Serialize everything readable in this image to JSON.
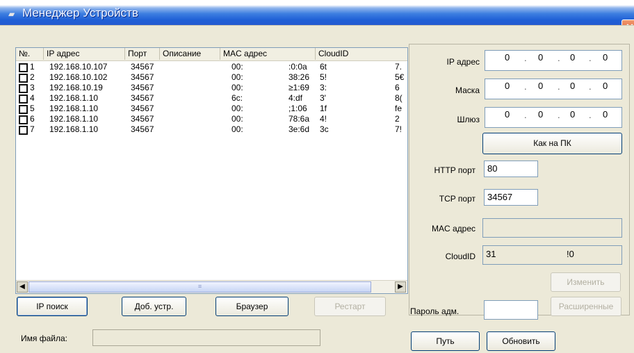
{
  "window": {
    "title": "Менеджер Устройств",
    "close_label": "✕"
  },
  "list": {
    "columns": [
      "№.",
      "IP адрес",
      "Порт",
      "Описание",
      "MAC адрес",
      "CloudID"
    ],
    "rows": [
      {
        "n": "1",
        "ip": "192.168.10.107",
        "port": "34567",
        "desc": "",
        "mac_a": "00:",
        "mac_b": ":0:0a",
        "cloud_a": "6t",
        "cloud_b": "7."
      },
      {
        "n": "2",
        "ip": "192.168.10.102",
        "port": "34567",
        "desc": "",
        "mac_a": "00:",
        "mac_b": "38:26",
        "cloud_a": "5!",
        "cloud_b": "5€"
      },
      {
        "n": "3",
        "ip": "192.168.10.19",
        "port": "34567",
        "desc": "",
        "mac_a": "00:",
        "mac_b": "≥1:69",
        "cloud_a": "3:",
        "cloud_b": "6"
      },
      {
        "n": "4",
        "ip": "192.168.1.10",
        "port": "34567",
        "desc": "",
        "mac_a": "6c:",
        "mac_b": "4:df",
        "cloud_a": "3'",
        "cloud_b": "8("
      },
      {
        "n": "5",
        "ip": "192.168.1.10",
        "port": "34567",
        "desc": "",
        "mac_a": "00:",
        "mac_b": ";1:06",
        "cloud_a": "1f",
        "cloud_b": "fe"
      },
      {
        "n": "6",
        "ip": "192.168.1.10",
        "port": "34567",
        "desc": "",
        "mac_a": "00:",
        "mac_b": "78:6a",
        "cloud_a": "4!",
        "cloud_b": "2"
      },
      {
        "n": "7",
        "ip": "192.168.1.10",
        "port": "34567",
        "desc": "",
        "mac_a": "00:",
        "mac_b": "3e:6d",
        "cloud_a": "3c",
        "cloud_b": "7!"
      }
    ],
    "scroll_left": "◀",
    "scroll_right": "▶",
    "scroll_grip": "≡"
  },
  "buttons": {
    "ip_search": "IP поиск",
    "add_device": "Доб. устр.",
    "browser": "Браузер",
    "restart": "Рестарт",
    "as_pc": "Как на ПК",
    "change": "Изменить",
    "advanced": "Расширенные",
    "path": "Путь",
    "update": "Обновить"
  },
  "settings": {
    "ip_label": "IP адрес",
    "mask_label": "Маска",
    "gateway_label": "Шлюз",
    "ip_octets": [
      "0",
      "0",
      "0",
      "0"
    ],
    "mask_octets": [
      "0",
      "0",
      "0",
      "0"
    ],
    "gateway_octets": [
      "0",
      "0",
      "0",
      "0"
    ],
    "http_label": "HTTP порт",
    "http_value": "80",
    "tcp_label": "TCP порт",
    "tcp_value": "34567",
    "mac_label": "MAC адрес",
    "mac_value": "",
    "cloud_label": "CloudID",
    "cloud_value_a": "31",
    "cloud_value_b": "!0",
    "password_label": "Пароль адм.",
    "password_value": ""
  },
  "footer": {
    "filename_label": "Имя файла:",
    "filename_value": ""
  },
  "colors": {
    "title_blue": "#245ad0",
    "close_red": "#d9532c",
    "panel_bg": "#ece9d8"
  }
}
